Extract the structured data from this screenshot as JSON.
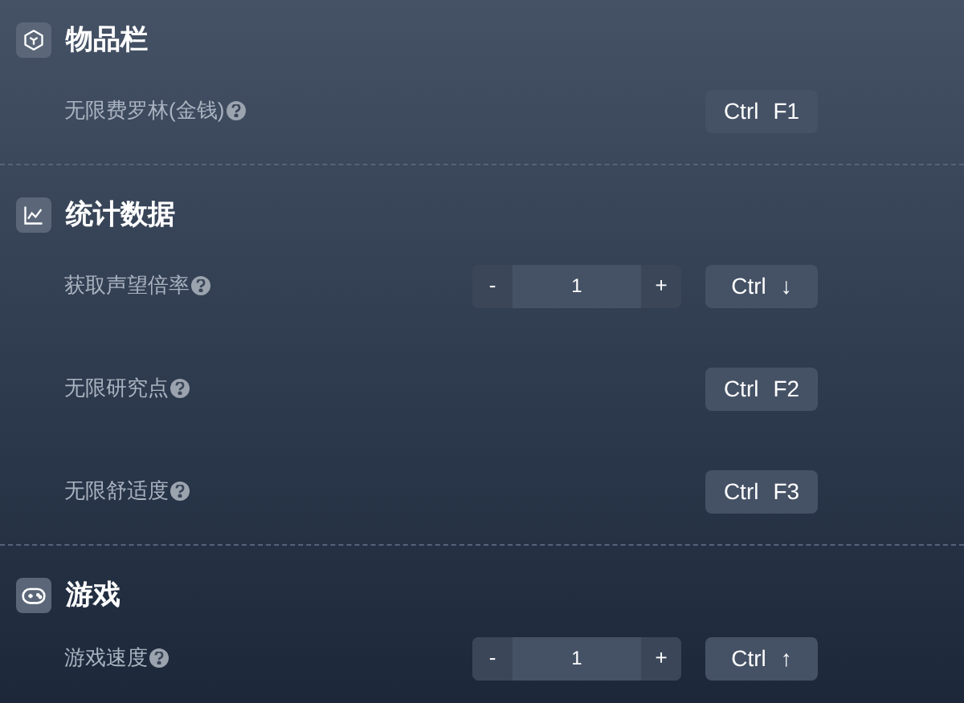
{
  "sections": [
    {
      "title": "物品栏",
      "kind": "cube",
      "rows": [
        {
          "label": "无限费罗林(金钱)",
          "kind": "toggle",
          "keys": [
            "Ctrl",
            "F1"
          ]
        }
      ]
    },
    {
      "title": "统计数据",
      "kind": "chart",
      "rows": [
        {
          "label": "获取声望倍率",
          "kind": "stepper",
          "decrement": "-",
          "value": "1",
          "increment": "+",
          "keys": [
            "Ctrl",
            "↓"
          ]
        },
        {
          "label": "无限研究点",
          "kind": "toggle",
          "keys": [
            "Ctrl",
            "F2"
          ]
        },
        {
          "label": "无限舒适度",
          "kind": "toggle",
          "keys": [
            "Ctrl",
            "F3"
          ]
        }
      ]
    },
    {
      "title": "游戏",
      "kind": "gamepad",
      "rows": [
        {
          "label": "游戏速度",
          "kind": "stepper",
          "decrement": "-",
          "value": "1",
          "increment": "+",
          "keys": [
            "Ctrl",
            "↑"
          ]
        }
      ]
    }
  ]
}
